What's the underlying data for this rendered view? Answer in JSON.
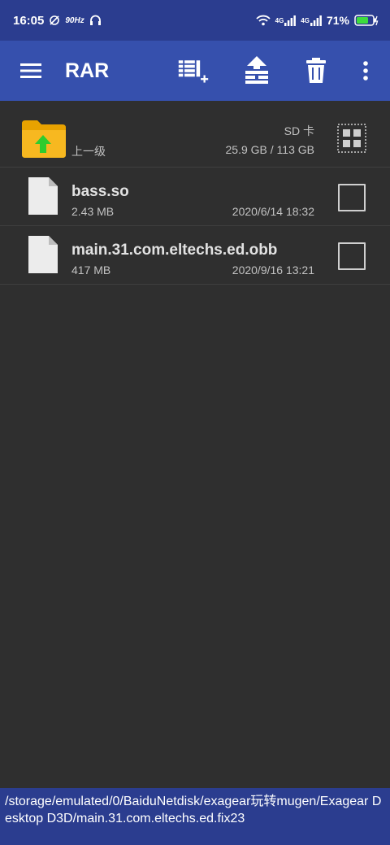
{
  "status_bar": {
    "time": "16:05",
    "refresh_rate": "90Hz",
    "network1": "4G",
    "network2": "4G",
    "battery": "71%"
  },
  "app_bar": {
    "title": "RAR",
    "icons": [
      "menu-icon",
      "add-to-archive-icon",
      "extract-up-icon",
      "delete-icon",
      "more-vert-icon"
    ]
  },
  "parent_row": {
    "label": "上一级",
    "storage_label": "SD 卡",
    "storage_usage": "25.9 GB / 113 GB"
  },
  "files": [
    {
      "name": "bass.so",
      "size": "2.43 MB",
      "modified": "2020/6/14 18:32"
    },
    {
      "name": "main.31.com.eltechs.ed.obb",
      "size": "417 MB",
      "modified": "2020/9/16 13:21"
    }
  ],
  "path": "/storage/emulated/0/BaiduNetdisk/exagear玩转mugen/Exagear Desktop D3D/main.31.com.eltechs.ed.fix23",
  "colors": {
    "status_bar_bg": "#2b3d8f",
    "app_bar_bg": "#3650ad",
    "background": "#2f2f2f",
    "folder_yellow": "#f4b400",
    "up_arrow_green": "#2ecc2e"
  }
}
